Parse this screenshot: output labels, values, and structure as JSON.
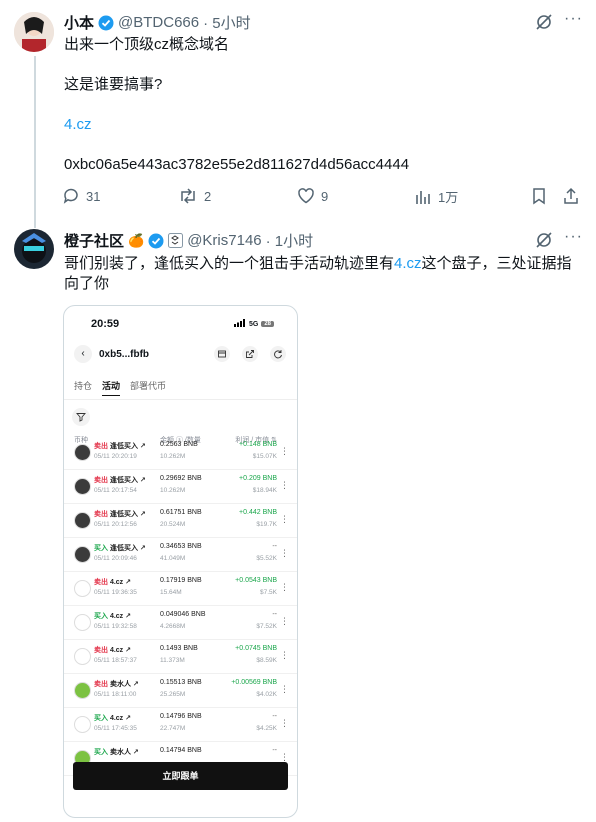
{
  "post1": {
    "name": "小本",
    "handle": "@BTDC666",
    "time": "· 5小时",
    "line1": "出来一个顶级cz概念域名",
    "line2": "这是谁要搞事?",
    "link": "4.cz",
    "address": "0xbc06a5e443ac3782e55e2d811627d4d56acc4444",
    "replies": "31",
    "reposts": "2",
    "likes": "9",
    "views": "1万"
  },
  "post2": {
    "name": "橙子社区",
    "emoji": "🍊",
    "handle": "@Kris7146",
    "time": "· 1小时",
    "text_a": "哥们别装了，逢低买入的一个狙击手活动轨迹里有",
    "text_link": "4.cz",
    "text_b": "这个盘子，三处证据指",
    "text_c": "向了你"
  },
  "phone": {
    "clock": "20:59",
    "signal": "5G",
    "battery": "28",
    "wallet": "0xb5...fbfb",
    "tabs": [
      "持仓",
      "活动",
      "部署代币"
    ],
    "col_headers": [
      "币种",
      "金额 ⓢ /数量",
      "利润 / 市值 ⇅"
    ],
    "cta": "立即跟单",
    "rows": [
      {
        "action": "卖出",
        "type": "sell",
        "token": "逢低买入",
        "date": "05/11 20:20:19",
        "amount": "0.2563 BNB",
        "qty": "10.262M",
        "profit": "+0.148 BNB",
        "mcap": "$15.07K"
      },
      {
        "action": "卖出",
        "type": "sell",
        "token": "逢低买入",
        "date": "05/11 20:17:54",
        "amount": "0.29692 BNB",
        "qty": "10.262M",
        "profit": "+0.209 BNB",
        "mcap": "$18.94K"
      },
      {
        "action": "卖出",
        "type": "sell",
        "token": "逢低买入",
        "date": "05/11 20:12:56",
        "amount": "0.61751 BNB",
        "qty": "20.524M",
        "profit": "+0.442 BNB",
        "mcap": "$19.7K"
      },
      {
        "action": "买入",
        "type": "buy",
        "token": "逢低买入",
        "date": "05/11 20:09:46",
        "amount": "0.34653 BNB",
        "qty": "41.049M",
        "profit": "--",
        "mcap": "$5.52K"
      },
      {
        "action": "卖出",
        "type": "sell",
        "token": "4.cz",
        "date": "05/11 19:36:35",
        "amount": "0.17919 BNB",
        "qty": "15.64M",
        "profit": "+0.0543 BNB",
        "mcap": "$7.5K"
      },
      {
        "action": "买入",
        "type": "buy",
        "token": "4.cz",
        "date": "05/11 19:32:58",
        "amount": "0.049046 BNB",
        "qty": "4.2668M",
        "profit": "--",
        "mcap": "$7.52K"
      },
      {
        "action": "卖出",
        "type": "sell",
        "token": "4.cz",
        "date": "05/11 18:57:37",
        "amount": "0.1493 BNB",
        "qty": "11.373M",
        "profit": "+0.0745 BNB",
        "mcap": "$8.59K"
      },
      {
        "action": "卖出",
        "type": "sell",
        "token": "卖水人",
        "date": "05/11 18:11:00",
        "amount": "0.15513 BNB",
        "qty": "25.265M",
        "profit": "+0.00569 BNB",
        "mcap": "$4.02K"
      },
      {
        "action": "买入",
        "type": "buy",
        "token": "4.cz",
        "date": "05/11 17:45:35",
        "amount": "0.14796 BNB",
        "qty": "22.747M",
        "profit": "--",
        "mcap": "$4.25K"
      },
      {
        "action": "买入",
        "type": "buy",
        "token": "卖水人",
        "date": "",
        "amount": "0.14794 BNB",
        "qty": "",
        "profit": "--",
        "mcap": ""
      }
    ]
  }
}
